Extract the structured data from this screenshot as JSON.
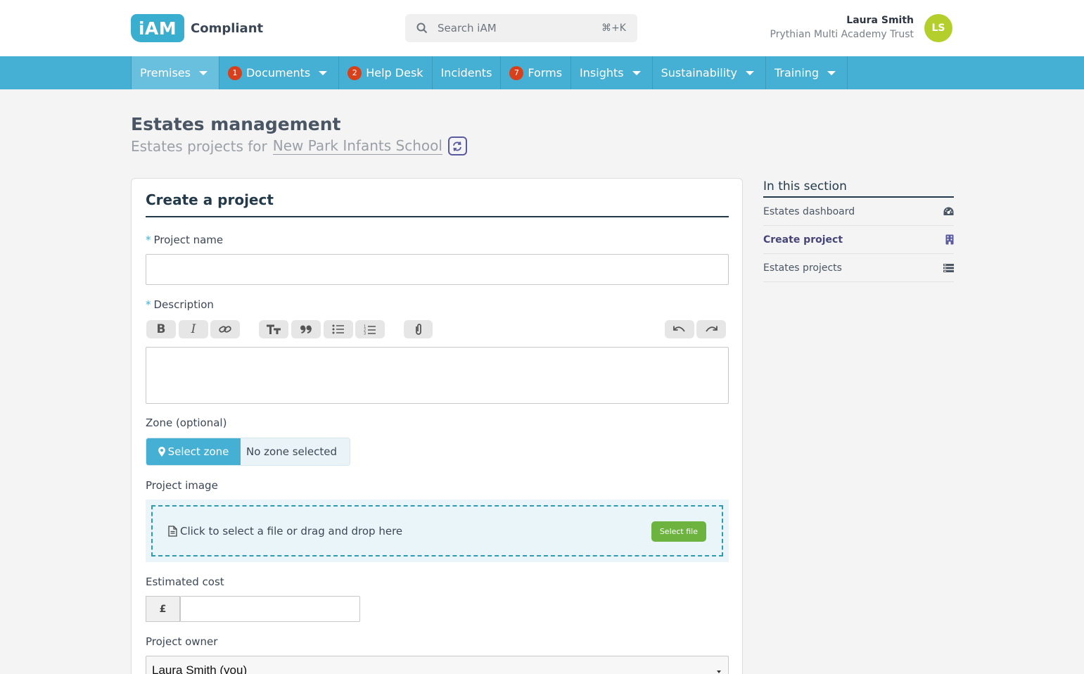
{
  "header": {
    "logo_mark": "iAM",
    "logo_text": "Compliant",
    "search_placeholder": "Search iAM",
    "search_shortcut": "⌘+K",
    "user_name": "Laura Smith",
    "user_org": "Prythian Multi Academy Trust",
    "avatar_initials": "LS"
  },
  "nav": {
    "items": [
      {
        "label": "Premises",
        "badge": "",
        "dropdown": true,
        "active": true
      },
      {
        "label": "Documents",
        "badge": "1",
        "dropdown": true
      },
      {
        "label": "Help Desk",
        "badge": "2",
        "dropdown": false
      },
      {
        "label": "Incidents",
        "badge": "",
        "dropdown": false
      },
      {
        "label": "Forms",
        "badge": "7",
        "dropdown": false
      },
      {
        "label": "Insights",
        "badge": "",
        "dropdown": true
      },
      {
        "label": "Sustainability",
        "badge": "",
        "dropdown": true
      },
      {
        "label": "Training",
        "badge": "",
        "dropdown": true
      }
    ]
  },
  "page": {
    "title": "Estates management",
    "subtitle_prefix": "Estates projects for",
    "school": "New Park Infants School"
  },
  "form": {
    "title": "Create a project",
    "required_marker": "*",
    "project_name_label": "Project name",
    "project_name_value": "",
    "description_label": "Description",
    "description_value": "",
    "zone_label": "Zone (optional)",
    "zone_button": "Select zone",
    "zone_status": "No zone selected",
    "image_label": "Project image",
    "dropzone_text": "Click to select a file or drag and drop here",
    "select_file": "Select file",
    "cost_label": "Estimated cost",
    "cost_prefix": "£",
    "cost_value": "",
    "owner_label": "Project owner",
    "owner_value": "Laura Smith (you)"
  },
  "toolbar": [
    "bold-icon",
    "italic-icon",
    "link-icon",
    "heading-icon",
    "quote-icon",
    "bullet-list-icon",
    "numbered-list-icon",
    "attach-icon",
    "undo-icon",
    "redo-icon"
  ],
  "sidebar": {
    "heading": "In this section",
    "items": [
      {
        "label": "Estates dashboard",
        "icon": "dashboard-icon"
      },
      {
        "label": "Create project",
        "icon": "building-icon",
        "current": true
      },
      {
        "label": "Estates projects",
        "icon": "list-icon"
      }
    ]
  },
  "colors": {
    "nav_bg": "#45b0d3",
    "badge": "#d8401c",
    "select_file": "#6cb33f",
    "avatar": "#b4cf2b"
  }
}
